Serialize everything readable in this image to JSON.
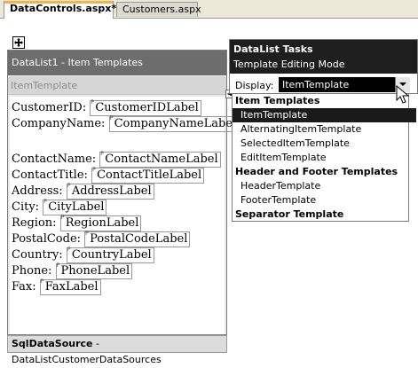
{
  "tabs": {
    "active": "DataControls.aspx*",
    "inactive": "Customers.aspx"
  },
  "datalist": {
    "header": "DataList1 - Item Templates",
    "section": "ItemTemplate",
    "fields": [
      {
        "label": "CustomerID:",
        "control": "CustomerIDLabel"
      },
      {
        "label": "CompanyName:",
        "control": "CompanyNameLabel"
      },
      {
        "label": "ContactName:",
        "control": "ContactNameLabel"
      },
      {
        "label": "ContactTitle:",
        "control": "ContactTitleLabel"
      },
      {
        "label": "Address:",
        "control": "AddressLabel"
      },
      {
        "label": "City:",
        "control": "CityLabel"
      },
      {
        "label": "Region:",
        "control": "RegionLabel"
      },
      {
        "label": "PostalCode:",
        "control": "PostalCodeLabel"
      },
      {
        "label": "Country:",
        "control": "CountryLabel"
      },
      {
        "label": "Phone:",
        "control": "PhoneLabel"
      },
      {
        "label": "Fax:",
        "control": "FaxLabel"
      }
    ]
  },
  "sqldatasource": {
    "type": "SqlDataSource",
    "name": " - DataListCustomerDataSources"
  },
  "tasks": {
    "title": "DataList Tasks",
    "subtitle": "Template Editing Mode",
    "display_label": "Display:",
    "display_value": "ItemTemplate"
  },
  "dropdown": {
    "items": [
      {
        "text": "Item Templates",
        "kind": "group"
      },
      {
        "text": "ItemTemplate",
        "kind": "option",
        "selected": true
      },
      {
        "text": "AlternatingItemTemplate",
        "kind": "option"
      },
      {
        "text": "SelectedItemTemplate",
        "kind": "option"
      },
      {
        "text": "EditItemTemplate",
        "kind": "option"
      },
      {
        "text": "Header and Footer Templates",
        "kind": "group"
      },
      {
        "text": "HeaderTemplate",
        "kind": "option"
      },
      {
        "text": "FooterTemplate",
        "kind": "option"
      },
      {
        "text": "Separator Template",
        "kind": "group"
      }
    ]
  },
  "icons": {
    "move": "move-handle-icon",
    "dropdown_arrow": "chevron-down-icon",
    "cursor": "pointer-cursor-icon",
    "smart_tag": "smart-tag-arrow-icon"
  }
}
